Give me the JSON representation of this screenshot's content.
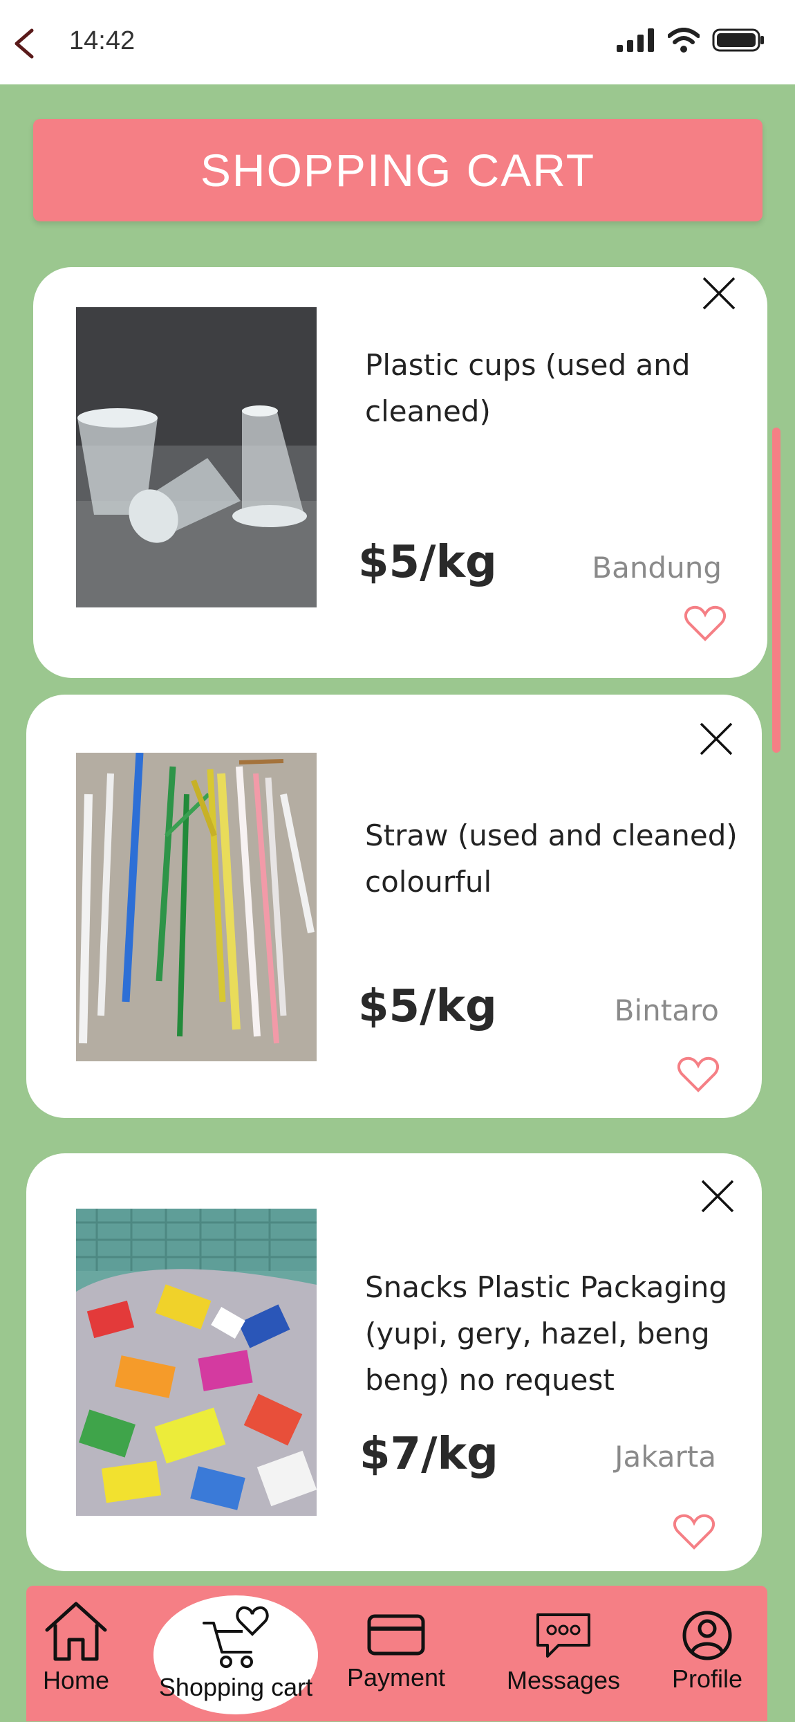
{
  "status_bar": {
    "time": "14:42"
  },
  "header": {
    "title": "SHOPPING CART"
  },
  "cart": {
    "items": [
      {
        "name_line1": "Plastic cups (used and",
        "name_line2": "cleaned)",
        "price": "$5/kg",
        "location": "Bandung"
      },
      {
        "name_line1": "Straw (used and cleaned)",
        "name_line2": "colourful",
        "price": "$5/kg",
        "location": "Bintaro"
      },
      {
        "name_line1": "Snacks Plastic Packaging",
        "name_line2": "(yupi, gery, hazel, beng",
        "name_line3": "beng) no request",
        "price": "$7/kg",
        "location": "Jakarta"
      }
    ]
  },
  "nav": {
    "home": "Home",
    "cart": "Shopping cart",
    "payment": "Payment",
    "messages": "Messages",
    "profile": "Profile"
  },
  "colors": {
    "background": "#9bc78f",
    "accent": "#f57f85",
    "card": "#ffffff"
  }
}
